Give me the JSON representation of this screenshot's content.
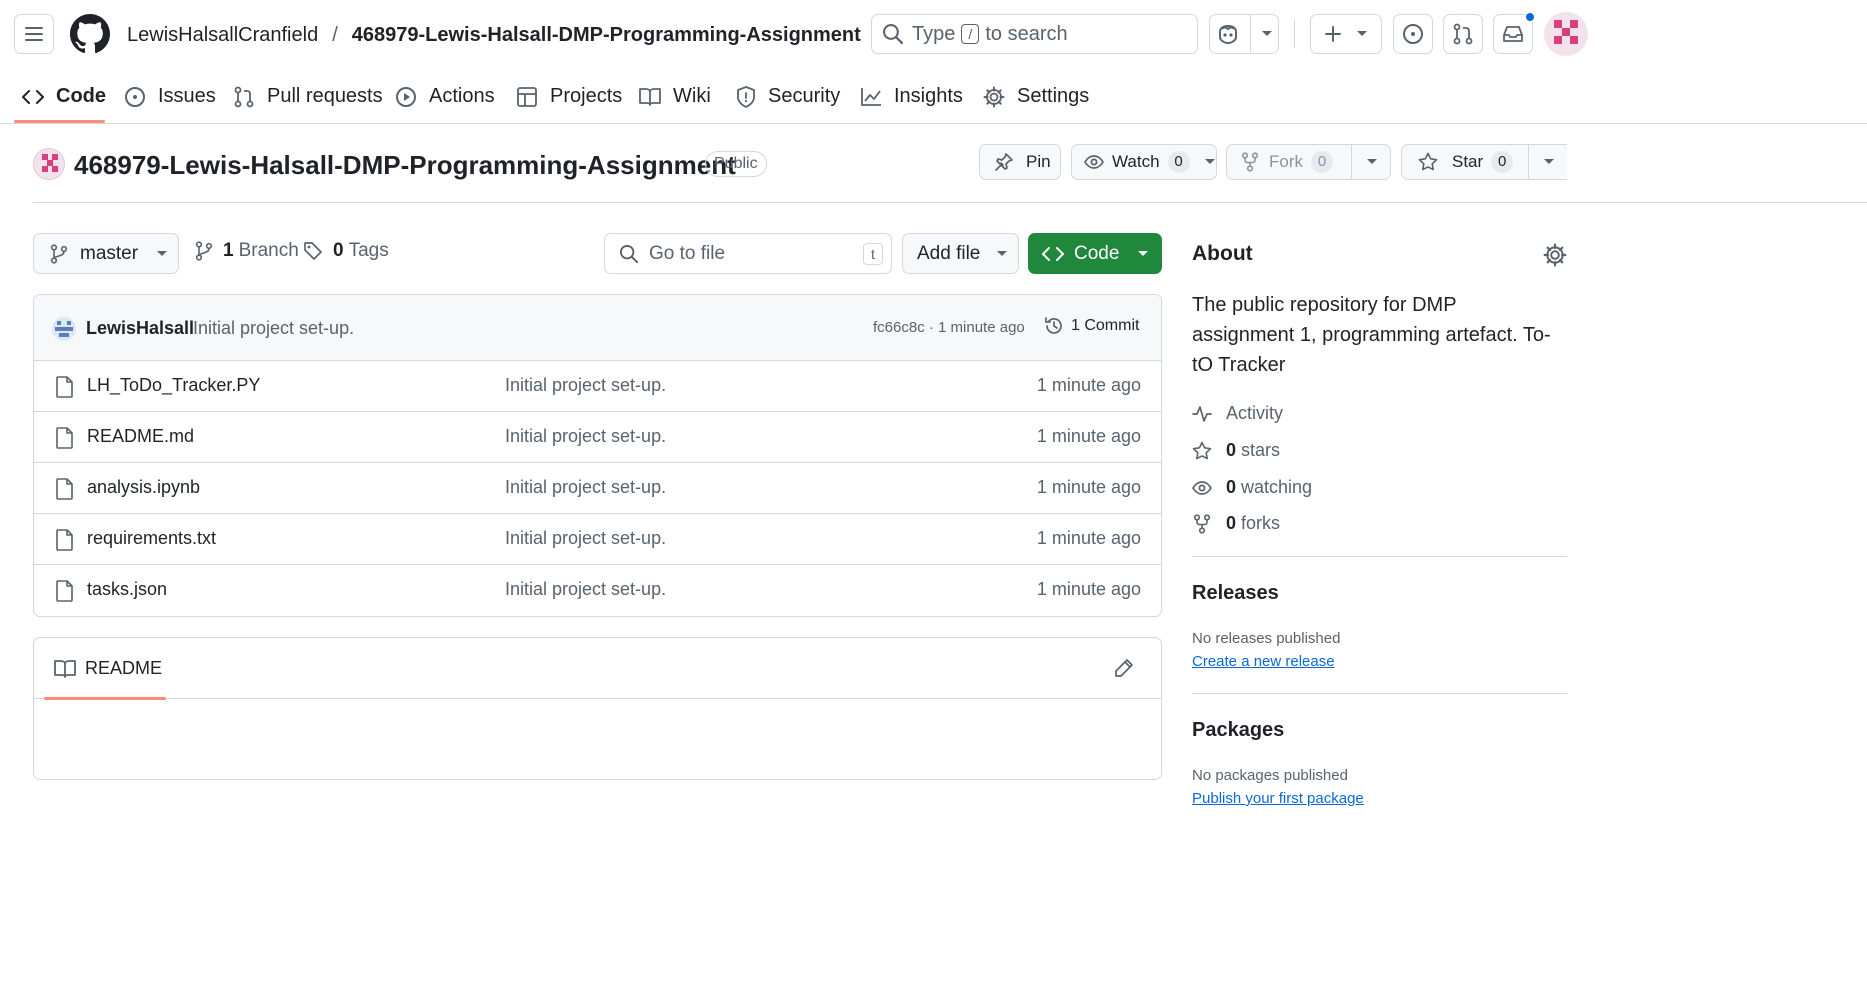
{
  "header": {
    "owner": "LewisHalsallCranfield",
    "separator": "/",
    "repo": "468979-Lewis-Halsall-DMP-Programming-Assignment",
    "search_type": "Type",
    "search_key": "/",
    "search_rest": "to search"
  },
  "nav": {
    "code": "Code",
    "issues": "Issues",
    "pulls": "Pull requests",
    "actions": "Actions",
    "projects": "Projects",
    "wiki": "Wiki",
    "security": "Security",
    "insights": "Insights",
    "settings": "Settings"
  },
  "repo": {
    "title": "468979-Lewis-Halsall-DMP-Programming-Assignment",
    "visibility": "Public",
    "pin_label": "Pin",
    "watch_label": "Watch",
    "watch_count": "0",
    "fork_label": "Fork",
    "fork_count": "0",
    "star_label": "Star",
    "star_count": "0"
  },
  "toolbar": {
    "branch": "master",
    "branch_count": "1",
    "branch_word": "Branch",
    "tag_count": "0",
    "tag_word": "Tags",
    "goto_placeholder": "Go to file",
    "goto_key": "t",
    "add_file": "Add file",
    "code_label": "Code"
  },
  "commit": {
    "author": "LewisHalsall",
    "message": "Initial project set-up.",
    "meta": "fc66c8c · 1 minute ago",
    "count_label": "1 Commit"
  },
  "files": [
    {
      "name": "LH_ToDo_Tracker.PY",
      "message": "Initial project set-up.",
      "age": "1 minute ago"
    },
    {
      "name": "README.md",
      "message": "Initial project set-up.",
      "age": "1 minute ago"
    },
    {
      "name": "analysis.ipynb",
      "message": "Initial project set-up.",
      "age": "1 minute ago"
    },
    {
      "name": "requirements.txt",
      "message": "Initial project set-up.",
      "age": "1 minute ago"
    },
    {
      "name": "tasks.json",
      "message": "Initial project set-up.",
      "age": "1 minute ago"
    }
  ],
  "readme": {
    "tab_label": "README"
  },
  "about": {
    "title": "About",
    "description": "The public repository for DMP assignment 1, programming artefact. To-tO Tracker",
    "activity": "Activity",
    "stars_count": "0",
    "stars_word": "stars",
    "watching_count": "0",
    "watching_word": "watching",
    "forks_count": "0",
    "forks_word": "forks"
  },
  "releases": {
    "title": "Releases",
    "note": "No releases published",
    "link": "Create a new release"
  },
  "packages": {
    "title": "Packages",
    "note": "No packages published",
    "link": "Publish your first package"
  },
  "colors": {
    "accent_green": "#1f883d",
    "link_blue": "#0969da",
    "underline_orange": "#fd8c73",
    "border": "#d1d9e0",
    "muted_text": "#59636e"
  }
}
